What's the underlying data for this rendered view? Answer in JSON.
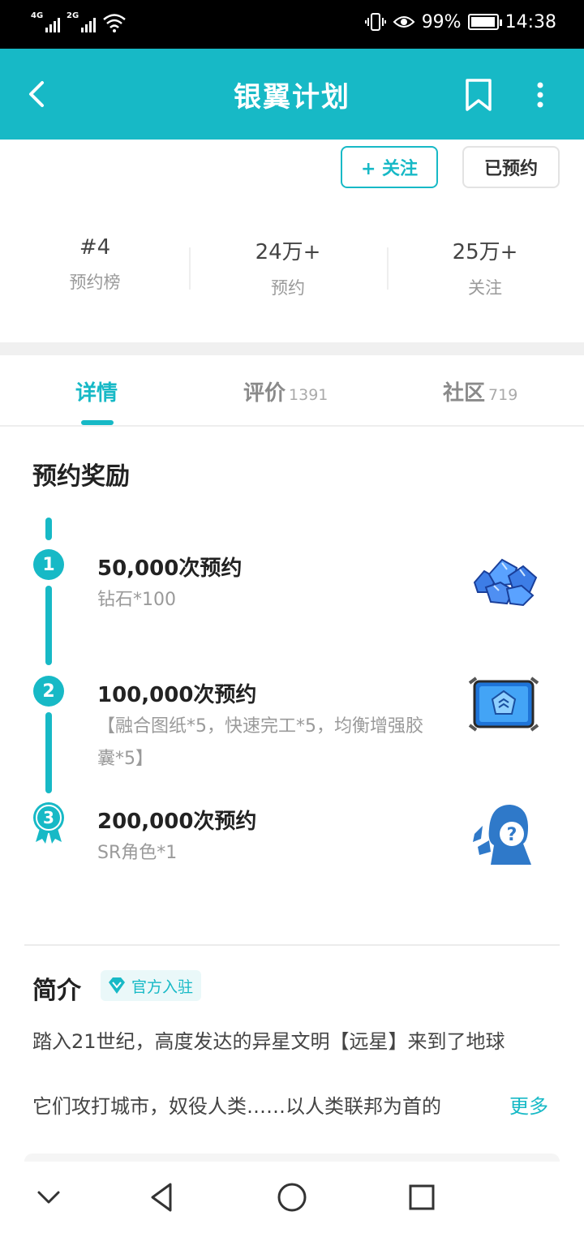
{
  "status_bar": {
    "net1": "4G",
    "net2": "2G",
    "battery": "99%",
    "battery_level": 0.99,
    "time": "14:38"
  },
  "header": {
    "title": "银翼计划"
  },
  "actions": {
    "follow_label": "+ 关注",
    "reserved_label": "已预约"
  },
  "stats": [
    {
      "value": "#4",
      "label": "预约榜"
    },
    {
      "value": "24万+",
      "label": "预约"
    },
    {
      "value": "25万+",
      "label": "关注"
    }
  ],
  "tabs": [
    {
      "label": "详情",
      "count": ""
    },
    {
      "label": "评价",
      "count": "1391"
    },
    {
      "label": "社区",
      "count": "719"
    }
  ],
  "rewards": {
    "section_title": "预约奖励",
    "items": [
      {
        "step": "1",
        "title": "50,000次预约",
        "desc": "钻石*100",
        "icon": "diamond-pile-icon"
      },
      {
        "step": "2",
        "title": "100,000次预约",
        "desc": "【融合图纸*5，快速完工*5，均衡增强胶囊*5】",
        "icon": "blueprint-icon"
      },
      {
        "step": "3",
        "title": "200,000次预约",
        "desc": "SR角色*1",
        "icon": "mystery-character-icon"
      }
    ]
  },
  "intro": {
    "title": "简介",
    "badge": "官方入驻",
    "text": "踏入21世纪，高度发达的异星文明【远星】来到了地球",
    "text_line3": "它们攻打城市，奴役人类……以人类联邦为首的",
    "more": "更多"
  },
  "colors": {
    "accent": "#17b9c6",
    "status_bar": "#000000"
  }
}
